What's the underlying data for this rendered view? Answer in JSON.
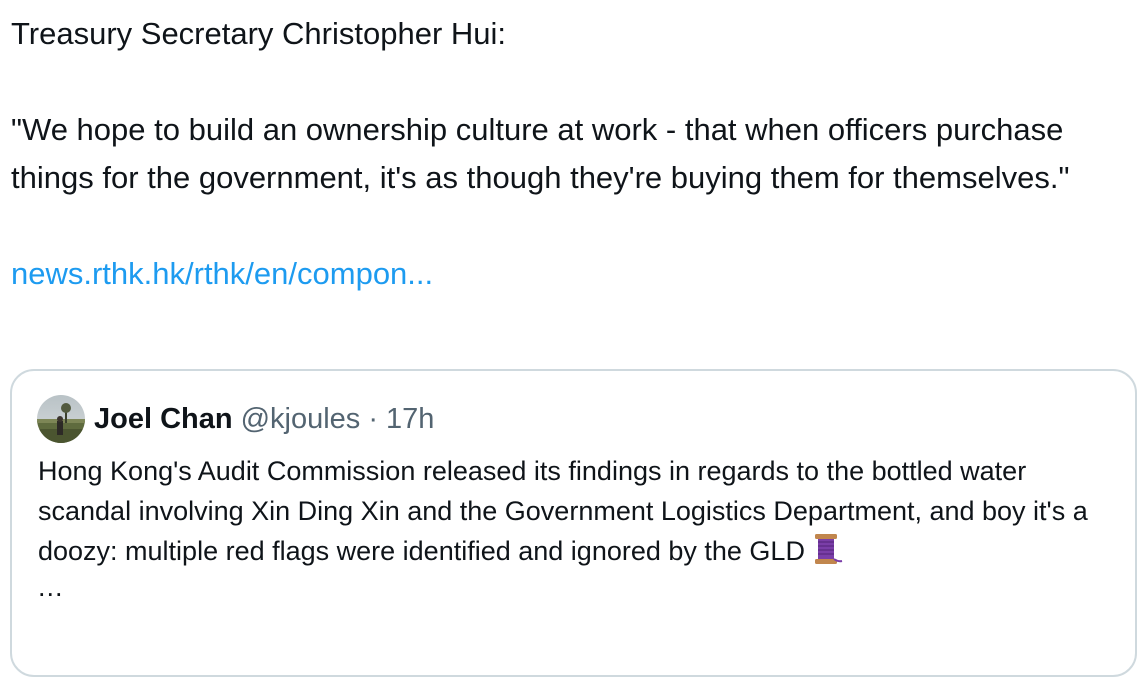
{
  "tweet": {
    "line1": "Treasury Secretary Christopher Hui:",
    "quote_text": "\"We hope to build an ownership culture at work - that when officers purchase things for the government, it's as though they're buying them for themselves.\"",
    "link_text": "news.rthk.hk/rthk/en/compon..."
  },
  "quoted_tweet": {
    "name": "Joel Chan",
    "handle": "@kjoules",
    "separator": "·",
    "time": "17h",
    "text": "Hong Kong's Audit Commission released its findings in regards to the bottled water scandal involving Xin Ding Xin and the Government Logistics Department, and boy it's a doozy: multiple red flags were identified and ignored by the GLD",
    "emoji_icon": "thread-spool-icon",
    "ellipsis": "..."
  },
  "colors": {
    "text": "#0f1419",
    "secondary": "#536471",
    "link": "#1d9bf0",
    "border": "#cfd9de"
  }
}
